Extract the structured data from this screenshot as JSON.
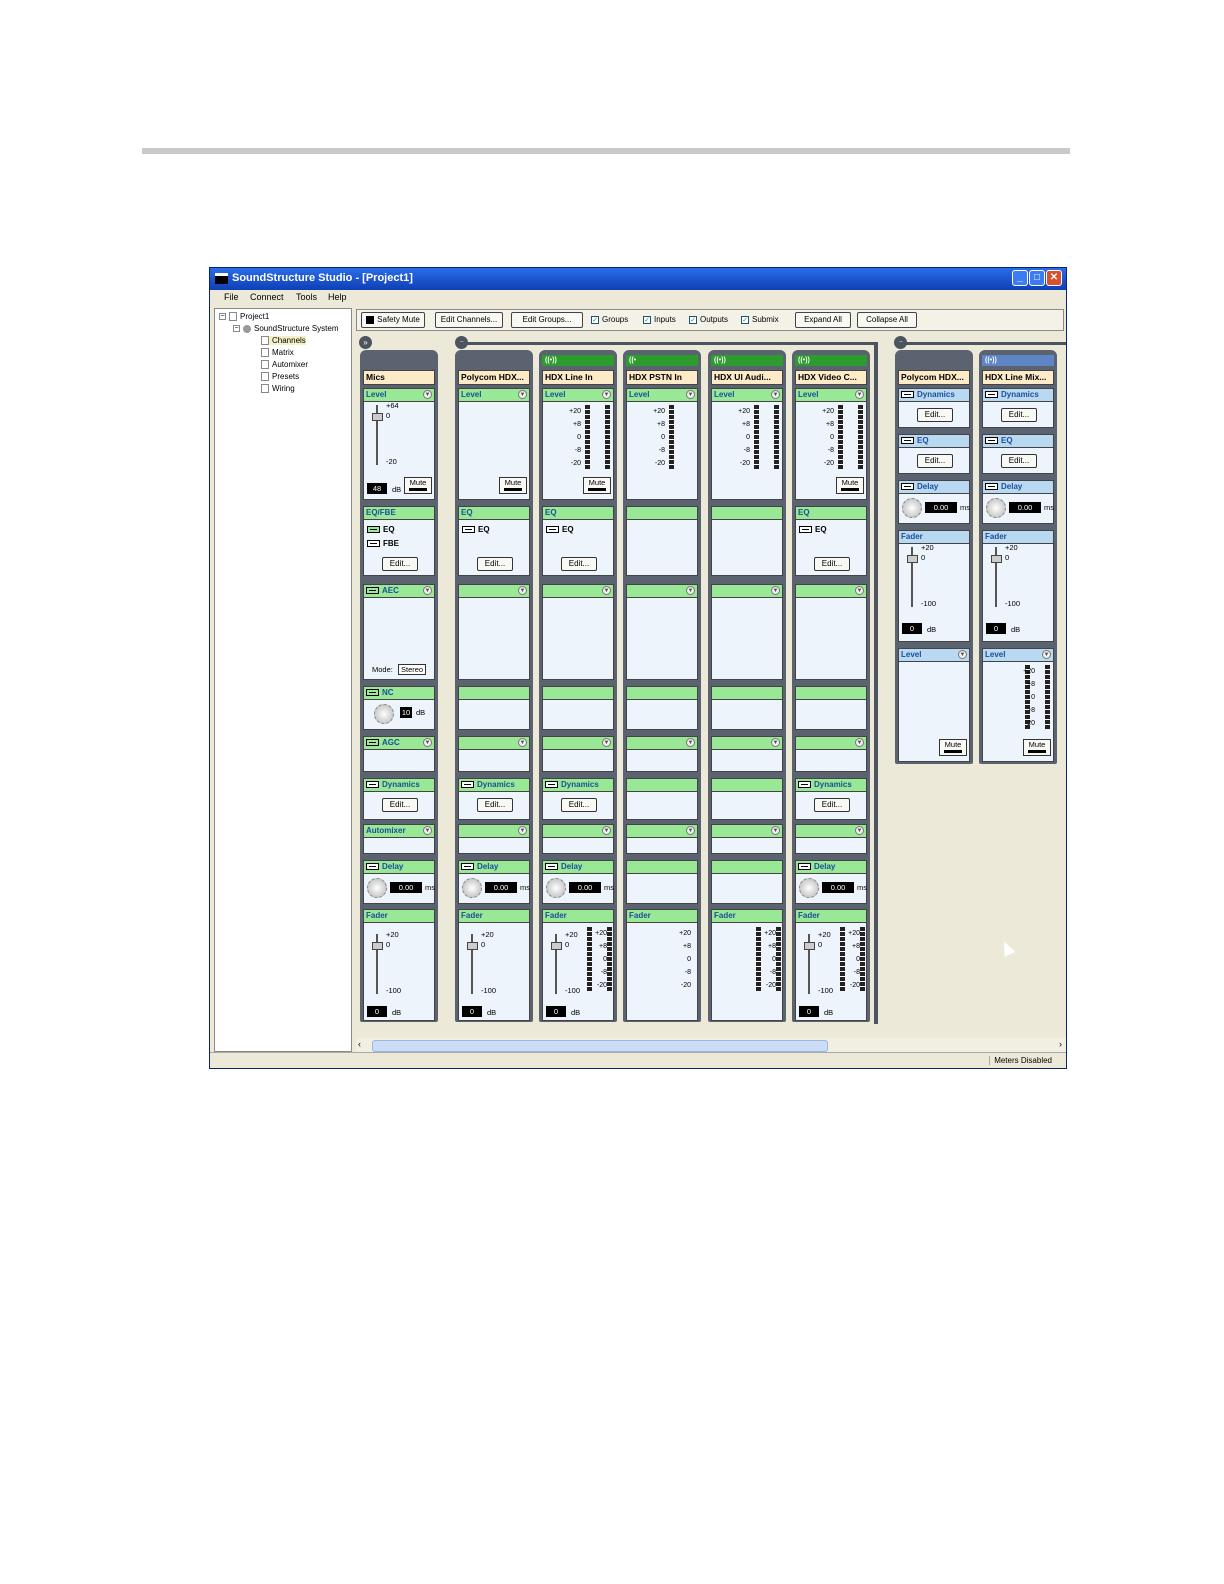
{
  "window": {
    "title": "SoundStructure Studio - [Project1]",
    "status": "Meters Disabled"
  },
  "menu": [
    "File",
    "Connect",
    "Tools",
    "Help"
  ],
  "tree": {
    "root": "Project1",
    "system": "SoundStructure System",
    "items": [
      "Channels",
      "Matrix",
      "Automixer",
      "Presets",
      "Wiring"
    ]
  },
  "toolbar": {
    "safety_mute": "Safety Mute",
    "edit_channels": "Edit Channels...",
    "edit_groups": "Edit Groups...",
    "checks": [
      {
        "label": "Groups",
        "checked": true
      },
      {
        "label": "Inputs",
        "checked": true
      },
      {
        "label": "Outputs",
        "checked": true
      },
      {
        "label": "Submix",
        "checked": true
      }
    ],
    "expand_all": "Expand All",
    "collapse_all": "Collapse All"
  },
  "labels": {
    "level": "Level",
    "eqfbe": "EQ/FBE",
    "eq": "EQ",
    "fbe": "FBE",
    "edit": "Edit...",
    "aec": "AEC",
    "mode": "Mode:",
    "mode_value": "Stereo",
    "nc": "NC",
    "agc": "AGC",
    "dynamics": "Dynamics",
    "automixer": "Automixer",
    "delay": "Delay",
    "fader": "Fader",
    "mute": "Mute",
    "db": "dB",
    "ms": "ms",
    "level_value": "48",
    "nc_value": "10",
    "delay_value": "0.00",
    "fader_value": "0",
    "scale": [
      "+20",
      "+8",
      "0",
      "-8",
      "-20"
    ],
    "fader_top": "+20",
    "fader_zero": "0",
    "fader_bottom": "-100",
    "gain_top": "+64",
    "gain_zero": "0",
    "gain_bottom": "-20"
  },
  "inputs": [
    {
      "name": "Mics",
      "icon": "group-collapse-icon"
    },
    {
      "name": "Polycom HDX...",
      "icon": "group-collapse-icon"
    },
    {
      "name": "HDX Line In",
      "tag": "((•))"
    },
    {
      "name": "HDX PSTN In",
      "tag": "((•"
    },
    {
      "name": "HDX UI Audi...",
      "tag": "((•))"
    },
    {
      "name": "HDX Video C...",
      "tag": "((•))"
    }
  ],
  "outputs": [
    {
      "name": "Polycom HDX..."
    },
    {
      "name": "HDX Line Mix...",
      "tag": "((•))"
    }
  ],
  "colors": {
    "titlebar": "#0f3fb4",
    "section_green": "#98e896",
    "section_blue": "#b9d8f2",
    "channel_header": "#fdebc8",
    "strip": "#5b6370"
  }
}
